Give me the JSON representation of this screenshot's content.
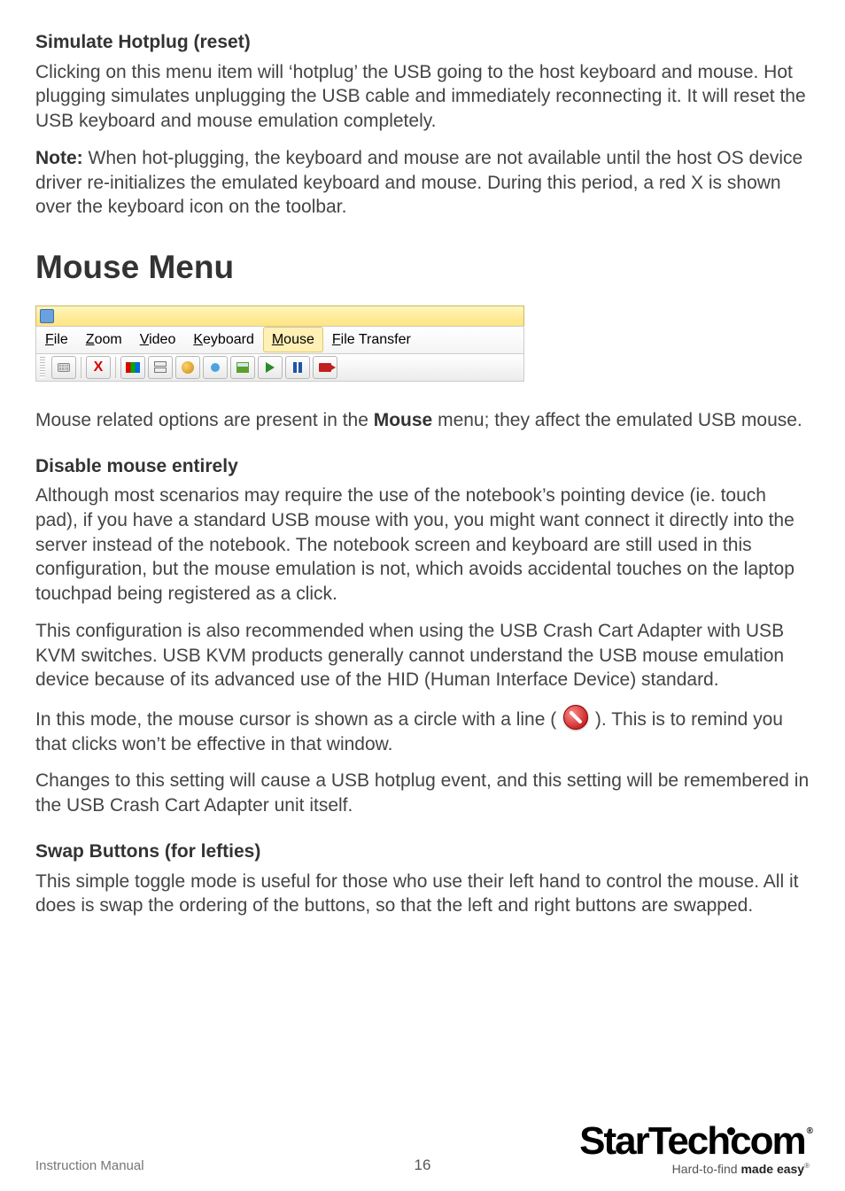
{
  "section1": {
    "title": "Simulate Hotplug (reset)",
    "p1": "Clicking on this menu item will ‘hotplug’ the USB going to the host keyboard and mouse. Hot plugging simulates unplugging the USB cable and immediately reconnecting it. It will reset the USB keyboard and mouse emulation completely.",
    "note_label": "Note:",
    "note_text": " When hot-plugging, the keyboard and mouse are not available until the host OS device driver re-initializes the emulated keyboard and mouse. During this period, a red X is shown over the keyboard icon on the toolbar."
  },
  "mouse_menu": {
    "heading": "Mouse Menu",
    "menubar": {
      "file": "File",
      "zoom": "Zoom",
      "video": "Video",
      "keyboard": "Keyboard",
      "mouse": "Mouse",
      "file_transfer": "File Transfer"
    },
    "intro_a": "Mouse related options are present in the ",
    "intro_bold": "Mouse",
    "intro_b": " menu; they affect the emulated USB mouse."
  },
  "disable": {
    "title": "Disable mouse entirely",
    "p1": "Although most scenarios may require the use of the notebook’s pointing device (ie. touch pad), if you have a standard USB mouse with you, you might want connect it directly into the server instead of the notebook. The notebook screen and keyboard are still used in this configuration, but the mouse emulation is not, which avoids accidental touches on the laptop touchpad being registered as a click.",
    "p2": "This configuration is also recommended when using the USB Crash Cart Adapter with USB KVM switches. USB KVM products generally cannot understand the USB mouse emulation device because of its advanced use of the HID (Human Interface Device) standard.",
    "p3a": "In this mode, the mouse cursor is shown as a circle with a line ( ",
    "p3b": " ). This is to remind you that clicks won’t be effective in that window.",
    "p4": "Changes to this setting will cause a USB hotplug event, and this setting will be remembered in the USB Crash Cart Adapter unit itself."
  },
  "swap": {
    "title": "Swap Buttons (for lefties)",
    "p1": "This simple toggle mode is useful for those who use their left hand to control the mouse. All it does is swap the ordering of the buttons, so that the left and right buttons are swapped."
  },
  "footer": {
    "left": "Instruction Manual",
    "page": "16",
    "brand_a": "Star",
    "brand_b": "Tech",
    "brand_c": "com",
    "tag_a": "Hard-to-find ",
    "tag_b": "made easy"
  }
}
